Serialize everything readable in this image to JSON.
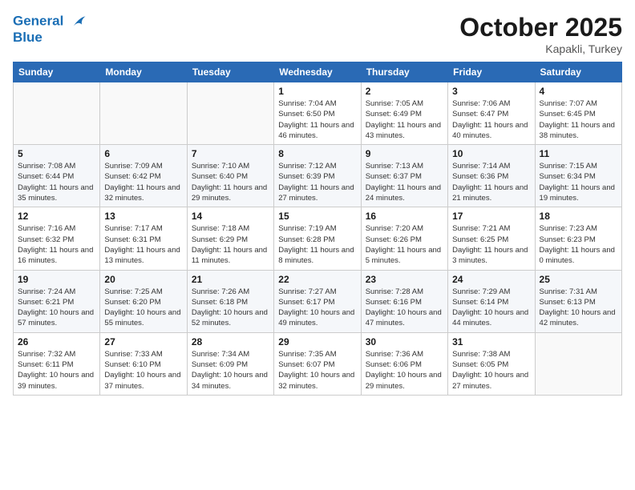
{
  "header": {
    "logo_line1": "General",
    "logo_line2": "Blue",
    "month": "October 2025",
    "location": "Kapakli, Turkey"
  },
  "weekdays": [
    "Sunday",
    "Monday",
    "Tuesday",
    "Wednesday",
    "Thursday",
    "Friday",
    "Saturday"
  ],
  "weeks": [
    [
      {
        "day": "",
        "sunrise": "",
        "sunset": "",
        "daylight": ""
      },
      {
        "day": "",
        "sunrise": "",
        "sunset": "",
        "daylight": ""
      },
      {
        "day": "",
        "sunrise": "",
        "sunset": "",
        "daylight": ""
      },
      {
        "day": "1",
        "sunrise": "Sunrise: 7:04 AM",
        "sunset": "Sunset: 6:50 PM",
        "daylight": "Daylight: 11 hours and 46 minutes."
      },
      {
        "day": "2",
        "sunrise": "Sunrise: 7:05 AM",
        "sunset": "Sunset: 6:49 PM",
        "daylight": "Daylight: 11 hours and 43 minutes."
      },
      {
        "day": "3",
        "sunrise": "Sunrise: 7:06 AM",
        "sunset": "Sunset: 6:47 PM",
        "daylight": "Daylight: 11 hours and 40 minutes."
      },
      {
        "day": "4",
        "sunrise": "Sunrise: 7:07 AM",
        "sunset": "Sunset: 6:45 PM",
        "daylight": "Daylight: 11 hours and 38 minutes."
      }
    ],
    [
      {
        "day": "5",
        "sunrise": "Sunrise: 7:08 AM",
        "sunset": "Sunset: 6:44 PM",
        "daylight": "Daylight: 11 hours and 35 minutes."
      },
      {
        "day": "6",
        "sunrise": "Sunrise: 7:09 AM",
        "sunset": "Sunset: 6:42 PM",
        "daylight": "Daylight: 11 hours and 32 minutes."
      },
      {
        "day": "7",
        "sunrise": "Sunrise: 7:10 AM",
        "sunset": "Sunset: 6:40 PM",
        "daylight": "Daylight: 11 hours and 29 minutes."
      },
      {
        "day": "8",
        "sunrise": "Sunrise: 7:12 AM",
        "sunset": "Sunset: 6:39 PM",
        "daylight": "Daylight: 11 hours and 27 minutes."
      },
      {
        "day": "9",
        "sunrise": "Sunrise: 7:13 AM",
        "sunset": "Sunset: 6:37 PM",
        "daylight": "Daylight: 11 hours and 24 minutes."
      },
      {
        "day": "10",
        "sunrise": "Sunrise: 7:14 AM",
        "sunset": "Sunset: 6:36 PM",
        "daylight": "Daylight: 11 hours and 21 minutes."
      },
      {
        "day": "11",
        "sunrise": "Sunrise: 7:15 AM",
        "sunset": "Sunset: 6:34 PM",
        "daylight": "Daylight: 11 hours and 19 minutes."
      }
    ],
    [
      {
        "day": "12",
        "sunrise": "Sunrise: 7:16 AM",
        "sunset": "Sunset: 6:32 PM",
        "daylight": "Daylight: 11 hours and 16 minutes."
      },
      {
        "day": "13",
        "sunrise": "Sunrise: 7:17 AM",
        "sunset": "Sunset: 6:31 PM",
        "daylight": "Daylight: 11 hours and 13 minutes."
      },
      {
        "day": "14",
        "sunrise": "Sunrise: 7:18 AM",
        "sunset": "Sunset: 6:29 PM",
        "daylight": "Daylight: 11 hours and 11 minutes."
      },
      {
        "day": "15",
        "sunrise": "Sunrise: 7:19 AM",
        "sunset": "Sunset: 6:28 PM",
        "daylight": "Daylight: 11 hours and 8 minutes."
      },
      {
        "day": "16",
        "sunrise": "Sunrise: 7:20 AM",
        "sunset": "Sunset: 6:26 PM",
        "daylight": "Daylight: 11 hours and 5 minutes."
      },
      {
        "day": "17",
        "sunrise": "Sunrise: 7:21 AM",
        "sunset": "Sunset: 6:25 PM",
        "daylight": "Daylight: 11 hours and 3 minutes."
      },
      {
        "day": "18",
        "sunrise": "Sunrise: 7:23 AM",
        "sunset": "Sunset: 6:23 PM",
        "daylight": "Daylight: 11 hours and 0 minutes."
      }
    ],
    [
      {
        "day": "19",
        "sunrise": "Sunrise: 7:24 AM",
        "sunset": "Sunset: 6:21 PM",
        "daylight": "Daylight: 10 hours and 57 minutes."
      },
      {
        "day": "20",
        "sunrise": "Sunrise: 7:25 AM",
        "sunset": "Sunset: 6:20 PM",
        "daylight": "Daylight: 10 hours and 55 minutes."
      },
      {
        "day": "21",
        "sunrise": "Sunrise: 7:26 AM",
        "sunset": "Sunset: 6:18 PM",
        "daylight": "Daylight: 10 hours and 52 minutes."
      },
      {
        "day": "22",
        "sunrise": "Sunrise: 7:27 AM",
        "sunset": "Sunset: 6:17 PM",
        "daylight": "Daylight: 10 hours and 49 minutes."
      },
      {
        "day": "23",
        "sunrise": "Sunrise: 7:28 AM",
        "sunset": "Sunset: 6:16 PM",
        "daylight": "Daylight: 10 hours and 47 minutes."
      },
      {
        "day": "24",
        "sunrise": "Sunrise: 7:29 AM",
        "sunset": "Sunset: 6:14 PM",
        "daylight": "Daylight: 10 hours and 44 minutes."
      },
      {
        "day": "25",
        "sunrise": "Sunrise: 7:31 AM",
        "sunset": "Sunset: 6:13 PM",
        "daylight": "Daylight: 10 hours and 42 minutes."
      }
    ],
    [
      {
        "day": "26",
        "sunrise": "Sunrise: 7:32 AM",
        "sunset": "Sunset: 6:11 PM",
        "daylight": "Daylight: 10 hours and 39 minutes."
      },
      {
        "day": "27",
        "sunrise": "Sunrise: 7:33 AM",
        "sunset": "Sunset: 6:10 PM",
        "daylight": "Daylight: 10 hours and 37 minutes."
      },
      {
        "day": "28",
        "sunrise": "Sunrise: 7:34 AM",
        "sunset": "Sunset: 6:09 PM",
        "daylight": "Daylight: 10 hours and 34 minutes."
      },
      {
        "day": "29",
        "sunrise": "Sunrise: 7:35 AM",
        "sunset": "Sunset: 6:07 PM",
        "daylight": "Daylight: 10 hours and 32 minutes."
      },
      {
        "day": "30",
        "sunrise": "Sunrise: 7:36 AM",
        "sunset": "Sunset: 6:06 PM",
        "daylight": "Daylight: 10 hours and 29 minutes."
      },
      {
        "day": "31",
        "sunrise": "Sunrise: 7:38 AM",
        "sunset": "Sunset: 6:05 PM",
        "daylight": "Daylight: 10 hours and 27 minutes."
      },
      {
        "day": "",
        "sunrise": "",
        "sunset": "",
        "daylight": ""
      }
    ]
  ]
}
